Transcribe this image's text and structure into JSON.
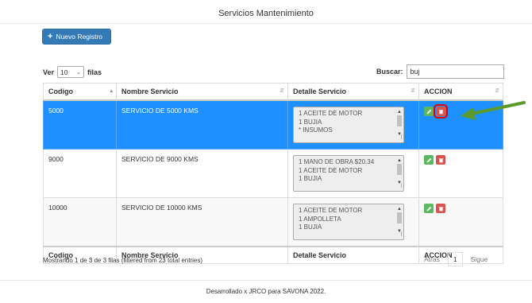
{
  "header": {
    "title": "Servicios Mantenimiento"
  },
  "toolbar": {
    "new_label": "Nuevo Registro",
    "new_icon": "plus-icon"
  },
  "length_control": {
    "prefix": "Ver",
    "value": "10",
    "suffix": "filas"
  },
  "search": {
    "label": "Buscar:",
    "value": "buj"
  },
  "table": {
    "columns": [
      "Codigo",
      "Nombre Servicio",
      "Detalle Servicio",
      "ACCION"
    ],
    "rows": [
      {
        "codigo": "5000",
        "nombre": "SERVICIO DE 5000 KMS",
        "detalle": [
          "1 ACEITE DE MOTOR",
          "1 BUJIA",
          "* INSUMOS"
        ],
        "selected": true
      },
      {
        "codigo": "9000",
        "nombre": "SERVICIO DE 9000 KMS",
        "detalle": [
          "1 MANO DE OBRA $20.34",
          "1 ACEITE DE MOTOR",
          "1 BUJIA"
        ],
        "selected": false
      },
      {
        "codigo": "10000",
        "nombre": "SERVICIO DE 10000 KMS",
        "detalle": [
          "1 ACEITE DE MOTOR",
          "1 AMPOLLETA",
          "1 BUJIA"
        ],
        "selected": false
      }
    ],
    "footer_columns": [
      "Codigo",
      "Nombre Servicio",
      "Detalle Servicio",
      "ACCION"
    ]
  },
  "info": {
    "text": "Mostrando 1 de 3 de 3 filas (filtered from 23 total entries)"
  },
  "pagination": {
    "prev": "Atras",
    "page": "1",
    "next": "Sigue"
  },
  "footer": {
    "text": "Desarrollado x JRCO para SAVONA 2022."
  },
  "colors": {
    "primary": "#337ab7",
    "selected_row": "#1e90ff",
    "edit": "#5cb85c",
    "delete": "#d9534f",
    "highlight": "#e00000",
    "arrow": "#5a9a2a"
  }
}
